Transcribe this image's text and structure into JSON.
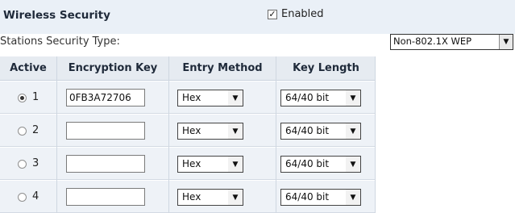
{
  "header": {
    "title": "Wireless Security",
    "enabled_label": "Enabled",
    "enabled_checked": true
  },
  "security_type": {
    "label": "Stations Security Type:",
    "value": "Non-802.1X WEP"
  },
  "table": {
    "columns": [
      "Active",
      "Encryption Key",
      "Entry Method",
      "Key Length"
    ],
    "rows": [
      {
        "num": "1",
        "active": true,
        "key": "0FB3A72706",
        "method": "Hex",
        "length": "64/40 bit"
      },
      {
        "num": "2",
        "active": false,
        "key": "",
        "method": "Hex",
        "length": "64/40 bit"
      },
      {
        "num": "3",
        "active": false,
        "key": "",
        "method": "Hex",
        "length": "64/40 bit"
      },
      {
        "num": "4",
        "active": false,
        "key": "",
        "method": "Hex",
        "length": "64/40 bit"
      }
    ]
  },
  "icons": {
    "checkbox": "checkmark-icon",
    "dropdown": "triangle-down-icon"
  }
}
